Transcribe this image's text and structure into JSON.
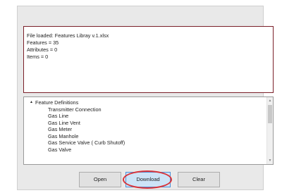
{
  "status": {
    "lines": [
      "File loaded: Features Libray v.1.xlsx",
      "Features = 35",
      "Attributes = 0",
      "Items = 0"
    ]
  },
  "tree": {
    "root_label": "Feature Definitions",
    "root_toggle_icon": "triangle-down-icon",
    "children": [
      "Transmitter Connection",
      "Gas Line",
      "Gas Line Vent",
      "Gas Meter",
      "Gas Manhole",
      "Gas Service Valve ( Curb Shutoff)",
      "Gas Valve"
    ]
  },
  "scrollbar": {
    "up_icon": "chevron-up-icon",
    "down_icon": "chevron-down-icon"
  },
  "buttons": {
    "open_label": "Open",
    "download_label": "Download",
    "clear_label": "Clear"
  },
  "colors": {
    "highlight": "#d8343a",
    "download_fill": "#cde4f7"
  }
}
